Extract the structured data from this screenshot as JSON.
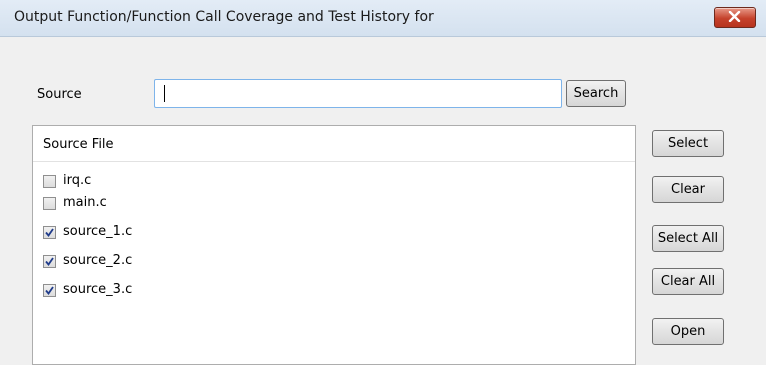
{
  "window": {
    "title": "Output Function/Function Call Coverage and Test History for",
    "close_icon": "close-icon"
  },
  "search": {
    "label": "Source",
    "value": "",
    "button_label": "Search"
  },
  "list": {
    "header": "Source File",
    "items": [
      {
        "label": "irq.c",
        "checked": false
      },
      {
        "label": "main.c",
        "checked": false
      },
      {
        "label": "source_1.c",
        "checked": true
      },
      {
        "label": "source_2.c",
        "checked": true
      },
      {
        "label": "source_3.c",
        "checked": true
      }
    ]
  },
  "buttons": {
    "select": "Select",
    "clear": "Clear",
    "select_all": "Select All",
    "clear_all": "Clear All",
    "open": "Open"
  },
  "colors": {
    "close_button": "#c5422c",
    "checkmark": "#1f3b8a",
    "input_border": "#7eb4ea"
  }
}
